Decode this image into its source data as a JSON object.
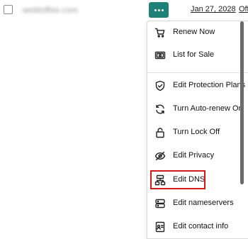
{
  "row": {
    "domain": "webtoffee.com",
    "expiry_date": "Jan 27, 2028",
    "auto_renew": "Off"
  },
  "menu": {
    "items": [
      {
        "label": "Renew Now",
        "icon": "cart-icon"
      },
      {
        "label": "List for Sale",
        "icon": "cash-icon"
      },
      {
        "label": "Edit Protection Plans",
        "icon": "shield-icon"
      },
      {
        "label": "Turn Auto-renew On",
        "icon": "refresh-icon"
      },
      {
        "label": "Turn Lock Off",
        "icon": "lock-icon"
      },
      {
        "label": "Edit Privacy",
        "icon": "eye-off-icon"
      },
      {
        "label": "Edit DNS",
        "icon": "dns-icon"
      },
      {
        "label": "Edit nameservers",
        "icon": "server-icon"
      },
      {
        "label": "Edit contact info",
        "icon": "contact-card-icon"
      }
    ],
    "highlighted_item": "Edit DNS"
  },
  "colors": {
    "accent": "#1f8077",
    "highlight_border": "#d11a1a"
  }
}
